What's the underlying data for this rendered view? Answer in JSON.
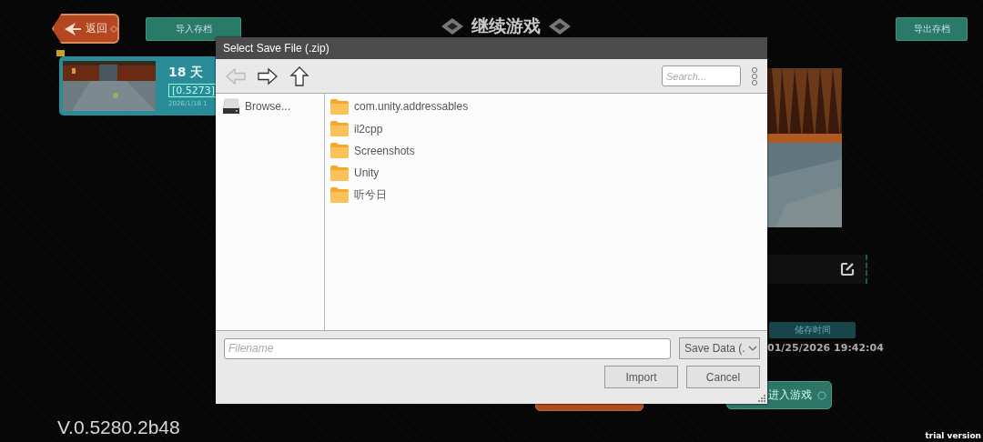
{
  "game": {
    "back_button": "返回",
    "import_button": "导入存档",
    "title": "继续游戏",
    "export_button": "导出存档",
    "save_card": {
      "days": "18 天",
      "version": "[0.5273]",
      "date": "2026/1/18 1"
    },
    "save_time_label": "储存时间",
    "save_time": "01/25/2026 19:42:04",
    "enter_button": "进入游戏",
    "version": "V.0.5280.2b48",
    "trial_label": "trial version"
  },
  "dialog": {
    "title": "Select Save File (.zip)",
    "nav_buttons": [
      {
        "kind": "back",
        "disabled": true
      },
      {
        "kind": "forward",
        "disabled": false
      },
      {
        "kind": "up",
        "disabled": false
      }
    ],
    "search": {
      "placeholder": "Search..."
    },
    "sidebar": [
      {
        "label": "Browse..."
      }
    ],
    "folders": [
      {
        "name": "com.unity.addressables"
      },
      {
        "name": "il2cpp"
      },
      {
        "name": "Screenshots"
      },
      {
        "name": "Unity"
      },
      {
        "name": "听兮日"
      }
    ],
    "filename": {
      "placeholder": "Filename"
    },
    "filter": "Save Data (.",
    "buttons": [
      "Import",
      "Cancel"
    ]
  }
}
